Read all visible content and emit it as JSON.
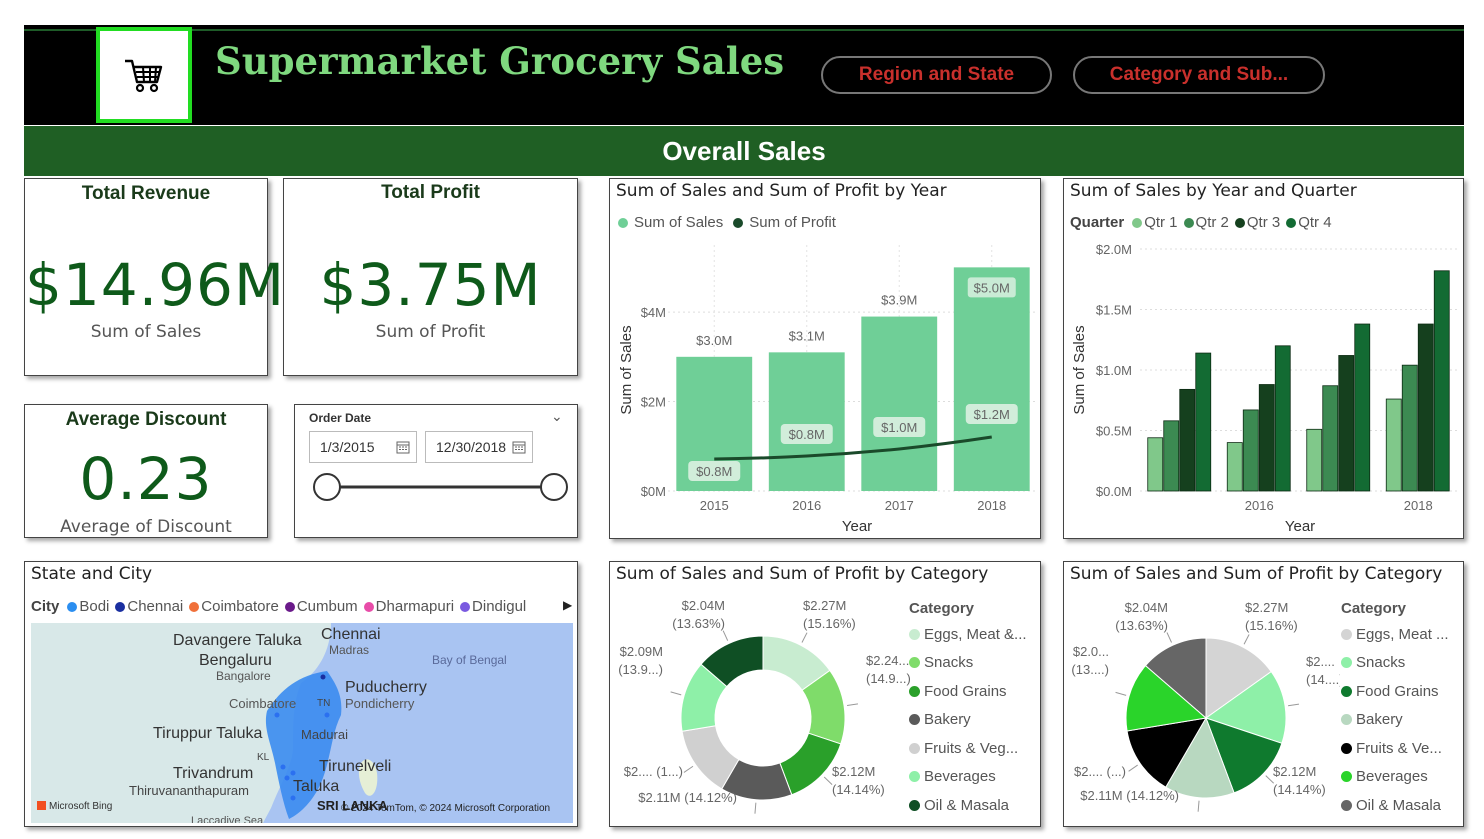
{
  "header": {
    "title": "Supermarket Grocery Sales",
    "logo_icon": "shopping-cart-icon",
    "nav_buttons": [
      "Region and State",
      "Category and Sub..."
    ]
  },
  "banner": {
    "title": "Overall Sales"
  },
  "kpis": {
    "revenue": {
      "title": "Total Revenue",
      "value": "$14.96M",
      "sub": "Sum of Sales"
    },
    "profit": {
      "title": "Total Profit",
      "value": "$3.75M",
      "sub": "Sum of Profit"
    },
    "discount": {
      "title": "Average Discount",
      "value": "0.23",
      "sub": "Average of Discount"
    }
  },
  "date_slicer": {
    "label": "Order Date",
    "start": "1/3/2015",
    "end": "12/30/2018",
    "calendar_icon": "calendar-icon",
    "chevron_icon": "chevron-down-icon"
  },
  "map": {
    "title": "State and City",
    "legend_label": "City",
    "cities": [
      {
        "name": "Bodi",
        "color": "#2b8ef0"
      },
      {
        "name": "Chennai",
        "color": "#1a2fa0"
      },
      {
        "name": "Coimbatore",
        "color": "#f0703a"
      },
      {
        "name": "Cumbum",
        "color": "#6a1a8a"
      },
      {
        "name": "Dharmapuri",
        "color": "#e84ca8"
      },
      {
        "name": "Dindigul",
        "color": "#7a5ae0"
      }
    ],
    "labels": {
      "davangere": "Davangere Taluka",
      "chennai": "Chennai",
      "madras": "Madras",
      "bengaluru": "Bengaluru",
      "bangalore": "Bangalore",
      "bay": "Bay of Bengal",
      "coimbatore": "Coimbatore",
      "tn": "TN",
      "puducherry": "Puducherry",
      "pondicherry": "Pondicherry",
      "tiruppur": "Tiruppur Taluka",
      "madurai": "Madurai",
      "kl": "KL",
      "trivandrum": "Trivandrum",
      "tirunelveli": "Tirunelveli",
      "taluka": "Taluka",
      "thiruvananthapuram": "Thiruvananthapuram",
      "srilanka": "SRI LANKA",
      "laccadive": "Laccadive Sea"
    },
    "bing": "Microsoft Bing",
    "copyright": "© 2024 TomTom, © 2024 Microsoft Corporation"
  },
  "chart_data": [
    {
      "type": "bar",
      "title": "Sum of Sales and Sum of Profit by Year",
      "categories": [
        "2015",
        "2016",
        "2017",
        "2018"
      ],
      "series": [
        {
          "name": "Sum of Sales",
          "kind": "bar",
          "color": "#6fcf97",
          "values": [
            3.0,
            3.1,
            3.9,
            5.0
          ],
          "labels": [
            "$3.0M",
            "$3.1M",
            "$3.9M",
            "$5.0M"
          ]
        },
        {
          "name": "Sum of Profit",
          "kind": "line",
          "color": "#1a4a2a",
          "values": [
            0.8,
            0.8,
            1.0,
            1.2
          ],
          "labels": [
            "$0.8M",
            "$0.8M",
            "$1.0M",
            "$1.2M"
          ]
        }
      ],
      "xlabel": "Year",
      "ylabel": "Sum of Sales",
      "yticks": [
        "$0M",
        "$2M",
        "$4M"
      ],
      "ylim": [
        0,
        5.5
      ]
    },
    {
      "type": "bar",
      "title": "Sum of Sales by Year and Quarter",
      "legend_label": "Quarter",
      "categories": [
        "2015",
        "2016",
        "2017",
        "2018"
      ],
      "tick_labels": [
        "2016",
        "2018"
      ],
      "series": [
        {
          "name": "Qtr 1",
          "color": "#80c88a",
          "values": [
            0.44,
            0.4,
            0.51,
            0.76
          ]
        },
        {
          "name": "Qtr 2",
          "color": "#3c8a52",
          "values": [
            0.58,
            0.67,
            0.87,
            1.04
          ]
        },
        {
          "name": "Qtr 3",
          "color": "#15401e",
          "values": [
            0.84,
            0.88,
            1.12,
            1.38
          ]
        },
        {
          "name": "Qtr 4",
          "color": "#136b33",
          "values": [
            1.14,
            1.2,
            1.38,
            1.82
          ]
        }
      ],
      "xlabel": "Year",
      "ylabel": "Sum of Sales",
      "yticks": [
        "$0.0M",
        "$0.5M",
        "$1.0M",
        "$1.5M",
        "$2.0M"
      ],
      "ylim": [
        0,
        2.0
      ]
    },
    {
      "type": "pie",
      "variant": "donut",
      "title": "Sum of Sales and Sum of Profit by Category",
      "legend_label": "Category",
      "slices": [
        {
          "name": "Eggs, Meat &...",
          "value": 2.27,
          "pct": 15.16,
          "color": "#c8ecd0",
          "label": "$2.27M",
          "label2": "(15.16%)"
        },
        {
          "name": "Snacks",
          "value": 2.24,
          "pct": 14.97,
          "color": "#7fdc6a",
          "label": "$2.24...",
          "label2": "(14.9...)"
        },
        {
          "name": "Food Grains",
          "value": 2.12,
          "pct": 14.14,
          "color": "#2aa02a",
          "label": "$2.12M",
          "label2": "(14.14%)"
        },
        {
          "name": "Bakery",
          "value": 2.11,
          "pct": 14.12,
          "color": "#5a5a5a",
          "label": "$2.11M (14.12%)",
          "label2": ""
        },
        {
          "name": "Fruits & Veg...",
          "value": 2.1,
          "pct": 14.02,
          "color": "#d0d0d0",
          "label": "$2.... (1...)",
          "label2": ""
        },
        {
          "name": "Beverages",
          "value": 2.09,
          "pct": 13.97,
          "color": "#8ef0a8",
          "label": "$2.09M",
          "label2": "(13.9...)"
        },
        {
          "name": "Oil & Masala",
          "value": 2.04,
          "pct": 13.63,
          "color": "#0f4f24",
          "label": "$2.04M",
          "label2": "(13.63%)"
        }
      ]
    },
    {
      "type": "pie",
      "title": "Sum of Sales and Sum of Profit by Category",
      "legend_label": "Category",
      "slices": [
        {
          "name": "Eggs, Meat ...",
          "value": 2.27,
          "pct": 15.16,
          "color": "#d4d4d4",
          "label": "$2.27M",
          "label2": "(15.16%)"
        },
        {
          "name": "Snacks",
          "value": 2.24,
          "pct": 14.97,
          "color": "#8ef0a8",
          "label": "$2....",
          "label2": "(14....)"
        },
        {
          "name": "Food Grains",
          "value": 2.12,
          "pct": 14.14,
          "color": "#0f7a2e",
          "label": "$2.12M",
          "label2": "(14.14%)"
        },
        {
          "name": "Bakery",
          "value": 2.11,
          "pct": 14.12,
          "color": "#b8d8c0",
          "label": "$2.11M (14.12%)",
          "label2": ""
        },
        {
          "name": "Fruits & Ve...",
          "value": 2.1,
          "pct": 14.02,
          "color": "#000000",
          "label": "$2.... (...)",
          "label2": ""
        },
        {
          "name": "Beverages",
          "value": 2.09,
          "pct": 13.97,
          "color": "#2ad42a",
          "label": "$2.0...",
          "label2": "(13....)"
        },
        {
          "name": "Oil & Masala",
          "value": 2.04,
          "pct": 13.63,
          "color": "#666666",
          "label": "$2.04M",
          "label2": "(13.63%)"
        }
      ]
    }
  ]
}
